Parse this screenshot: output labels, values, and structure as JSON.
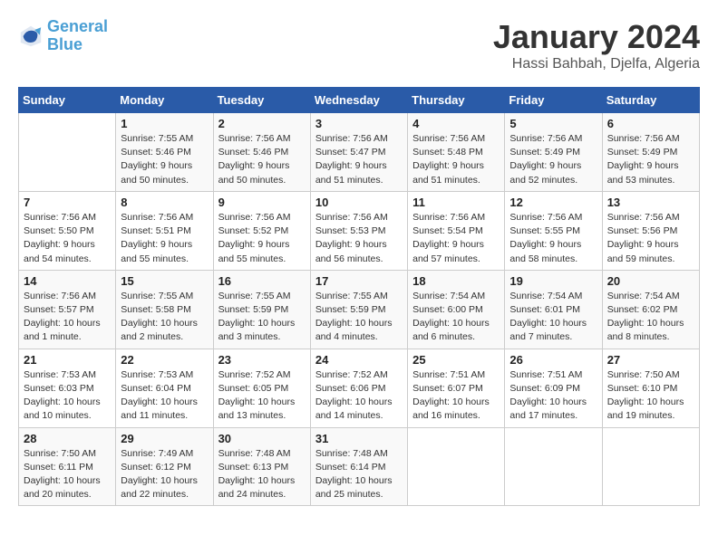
{
  "header": {
    "logo_line1": "General",
    "logo_line2": "Blue",
    "title": "January 2024",
    "subtitle": "Hassi Bahbah, Djelfa, Algeria"
  },
  "days_of_week": [
    "Sunday",
    "Monday",
    "Tuesday",
    "Wednesday",
    "Thursday",
    "Friday",
    "Saturday"
  ],
  "weeks": [
    [
      {
        "day": "",
        "info": ""
      },
      {
        "day": "1",
        "info": "Sunrise: 7:55 AM\nSunset: 5:46 PM\nDaylight: 9 hours\nand 50 minutes."
      },
      {
        "day": "2",
        "info": "Sunrise: 7:56 AM\nSunset: 5:46 PM\nDaylight: 9 hours\nand 50 minutes."
      },
      {
        "day": "3",
        "info": "Sunrise: 7:56 AM\nSunset: 5:47 PM\nDaylight: 9 hours\nand 51 minutes."
      },
      {
        "day": "4",
        "info": "Sunrise: 7:56 AM\nSunset: 5:48 PM\nDaylight: 9 hours\nand 51 minutes."
      },
      {
        "day": "5",
        "info": "Sunrise: 7:56 AM\nSunset: 5:49 PM\nDaylight: 9 hours\nand 52 minutes."
      },
      {
        "day": "6",
        "info": "Sunrise: 7:56 AM\nSunset: 5:49 PM\nDaylight: 9 hours\nand 53 minutes."
      }
    ],
    [
      {
        "day": "7",
        "info": "Sunrise: 7:56 AM\nSunset: 5:50 PM\nDaylight: 9 hours\nand 54 minutes."
      },
      {
        "day": "8",
        "info": "Sunrise: 7:56 AM\nSunset: 5:51 PM\nDaylight: 9 hours\nand 55 minutes."
      },
      {
        "day": "9",
        "info": "Sunrise: 7:56 AM\nSunset: 5:52 PM\nDaylight: 9 hours\nand 55 minutes."
      },
      {
        "day": "10",
        "info": "Sunrise: 7:56 AM\nSunset: 5:53 PM\nDaylight: 9 hours\nand 56 minutes."
      },
      {
        "day": "11",
        "info": "Sunrise: 7:56 AM\nSunset: 5:54 PM\nDaylight: 9 hours\nand 57 minutes."
      },
      {
        "day": "12",
        "info": "Sunrise: 7:56 AM\nSunset: 5:55 PM\nDaylight: 9 hours\nand 58 minutes."
      },
      {
        "day": "13",
        "info": "Sunrise: 7:56 AM\nSunset: 5:56 PM\nDaylight: 9 hours\nand 59 minutes."
      }
    ],
    [
      {
        "day": "14",
        "info": "Sunrise: 7:56 AM\nSunset: 5:57 PM\nDaylight: 10 hours\nand 1 minute."
      },
      {
        "day": "15",
        "info": "Sunrise: 7:55 AM\nSunset: 5:58 PM\nDaylight: 10 hours\nand 2 minutes."
      },
      {
        "day": "16",
        "info": "Sunrise: 7:55 AM\nSunset: 5:59 PM\nDaylight: 10 hours\nand 3 minutes."
      },
      {
        "day": "17",
        "info": "Sunrise: 7:55 AM\nSunset: 5:59 PM\nDaylight: 10 hours\nand 4 minutes."
      },
      {
        "day": "18",
        "info": "Sunrise: 7:54 AM\nSunset: 6:00 PM\nDaylight: 10 hours\nand 6 minutes."
      },
      {
        "day": "19",
        "info": "Sunrise: 7:54 AM\nSunset: 6:01 PM\nDaylight: 10 hours\nand 7 minutes."
      },
      {
        "day": "20",
        "info": "Sunrise: 7:54 AM\nSunset: 6:02 PM\nDaylight: 10 hours\nand 8 minutes."
      }
    ],
    [
      {
        "day": "21",
        "info": "Sunrise: 7:53 AM\nSunset: 6:03 PM\nDaylight: 10 hours\nand 10 minutes."
      },
      {
        "day": "22",
        "info": "Sunrise: 7:53 AM\nSunset: 6:04 PM\nDaylight: 10 hours\nand 11 minutes."
      },
      {
        "day": "23",
        "info": "Sunrise: 7:52 AM\nSunset: 6:05 PM\nDaylight: 10 hours\nand 13 minutes."
      },
      {
        "day": "24",
        "info": "Sunrise: 7:52 AM\nSunset: 6:06 PM\nDaylight: 10 hours\nand 14 minutes."
      },
      {
        "day": "25",
        "info": "Sunrise: 7:51 AM\nSunset: 6:07 PM\nDaylight: 10 hours\nand 16 minutes."
      },
      {
        "day": "26",
        "info": "Sunrise: 7:51 AM\nSunset: 6:09 PM\nDaylight: 10 hours\nand 17 minutes."
      },
      {
        "day": "27",
        "info": "Sunrise: 7:50 AM\nSunset: 6:10 PM\nDaylight: 10 hours\nand 19 minutes."
      }
    ],
    [
      {
        "day": "28",
        "info": "Sunrise: 7:50 AM\nSunset: 6:11 PM\nDaylight: 10 hours\nand 20 minutes."
      },
      {
        "day": "29",
        "info": "Sunrise: 7:49 AM\nSunset: 6:12 PM\nDaylight: 10 hours\nand 22 minutes."
      },
      {
        "day": "30",
        "info": "Sunrise: 7:48 AM\nSunset: 6:13 PM\nDaylight: 10 hours\nand 24 minutes."
      },
      {
        "day": "31",
        "info": "Sunrise: 7:48 AM\nSunset: 6:14 PM\nDaylight: 10 hours\nand 25 minutes."
      },
      {
        "day": "",
        "info": ""
      },
      {
        "day": "",
        "info": ""
      },
      {
        "day": "",
        "info": ""
      }
    ]
  ]
}
